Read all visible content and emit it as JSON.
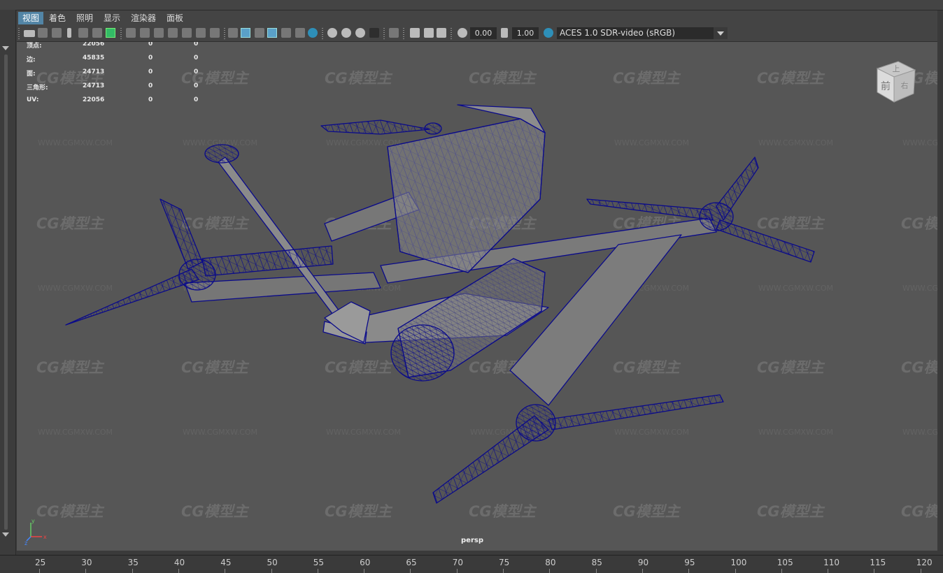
{
  "menu": {
    "items": [
      "视图",
      "着色",
      "照明",
      "显示",
      "渲染器",
      "面板"
    ]
  },
  "toolbar": {
    "exposure_value": "0.00",
    "gamma_value": "1.00",
    "color_space": "ACES 1.0 SDR-video (sRGB)"
  },
  "hud": {
    "rows": [
      {
        "label": "顶点:",
        "total": "22056",
        "selected": "0",
        "component": "0"
      },
      {
        "label": "边:",
        "total": "45835",
        "selected": "0",
        "component": "0"
      },
      {
        "label": "面:",
        "total": "24713",
        "selected": "0",
        "component": "0"
      },
      {
        "label": "三角形:",
        "total": "24713",
        "selected": "0",
        "component": "0"
      },
      {
        "label": "UV:",
        "total": "22056",
        "selected": "0",
        "component": "0"
      }
    ]
  },
  "viewport": {
    "camera_label": "persp",
    "watermark_text": "CG模型主",
    "watermark_url": "WWW.CGMXW.COM",
    "viewcube": {
      "top": "上",
      "front": "前",
      "right": "右"
    },
    "axis": {
      "x": "x",
      "y": "y",
      "z": "z"
    }
  },
  "timeline": {
    "ticks": [
      "25",
      "30",
      "35",
      "40",
      "45",
      "50",
      "55",
      "60",
      "65",
      "70",
      "75",
      "80",
      "85",
      "90",
      "95",
      "100",
      "105",
      "110",
      "115",
      "120"
    ]
  },
  "colors": {
    "wireframe": "#0a0a8a",
    "active_menu": "#5285a6",
    "viewport_bg": "#565656"
  }
}
